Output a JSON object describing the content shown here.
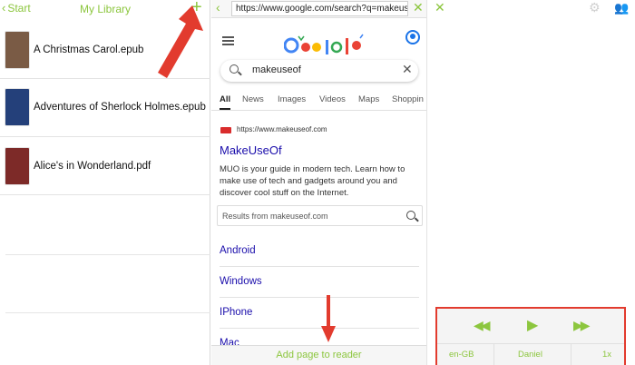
{
  "library": {
    "back_label": "Start",
    "title": "My Library",
    "add_symbol": "+",
    "books": [
      {
        "title": "A Christmas Carol.epub",
        "cover_color": "#7a5b45"
      },
      {
        "title": "Adventures of Sherlock Holmes.epub",
        "cover_color": "#24407a"
      },
      {
        "title": "Alice's in Wonderland.pdf",
        "cover_color": "#7d2a28"
      }
    ]
  },
  "browser": {
    "back_symbol": "<",
    "url": "https://www.google.com/search?q=makeus...",
    "close_symbol": "✕",
    "search_query": "makeuseof",
    "search_clear": "✕",
    "tabs": [
      "All",
      "News",
      "Images",
      "Videos",
      "Maps",
      "Shoppin"
    ],
    "result": {
      "url": "https://www.makeuseof.com",
      "title": "MakeUseOf",
      "description": "MUO is your guide in modern tech. Learn how to make use of tech and gadgets around you and discover cool stuff on the Internet.",
      "site_search_placeholder": "Results from makeuseof.com"
    },
    "sitelinks": [
      "Android",
      "Windows",
      "IPhone",
      "Mac"
    ],
    "add_page_label": "Add page to reader"
  },
  "reader": {
    "close_symbol": "✕",
    "gear_symbol": "⚙",
    "user_symbol": "👥",
    "controls": {
      "rewind": "◀◀",
      "play": "▶",
      "forward": "▶▶"
    },
    "language": "en-GB",
    "voice": "Daniel",
    "speed": "1x"
  },
  "colors": {
    "accent": "#8cc63e",
    "highlight": "#e23b2e",
    "link": "#1a0dab"
  },
  "icons": [
    "chevron-left-icon",
    "plus-icon",
    "hamburger-icon",
    "account-icon",
    "search-icon",
    "clear-icon",
    "gear-icon",
    "users-icon",
    "rewind-icon",
    "play-icon",
    "fast-forward-icon",
    "close-icon"
  ]
}
